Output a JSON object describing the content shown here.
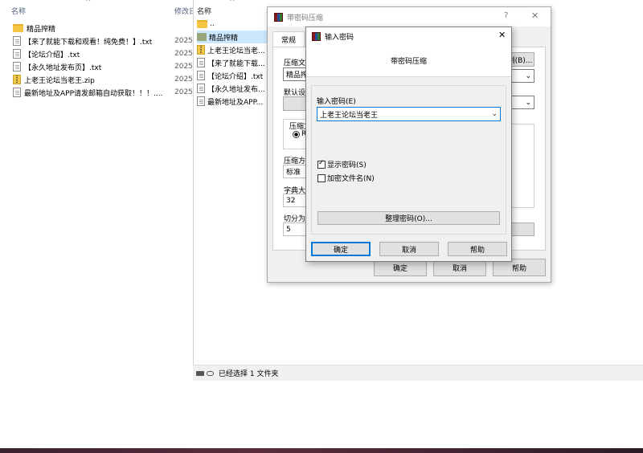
{
  "explorer_bg": {
    "col_name": "名称",
    "col_modified": "修改日",
    "files": [
      {
        "name": "精品搾精",
        "icon": "folder-icon",
        "date": ""
      },
      {
        "name": "【来了就能下载和观看！纯免费！】.txt",
        "icon": "txt-file-icon",
        "date": "2025"
      },
      {
        "name": "【论坛介绍】.txt",
        "icon": "txt-file-icon",
        "date": "2025"
      },
      {
        "name": "【永久地址发布页】.txt",
        "icon": "txt-file-icon",
        "date": "2025"
      },
      {
        "name": "上老王论坛当老王.zip",
        "icon": "zip-file-icon",
        "date": "2025"
      },
      {
        "name": "最新地址及APP请发邮箱自动获取！！！....",
        "icon": "txt-file-icon",
        "date": "2025"
      }
    ]
  },
  "explorer_mid": {
    "col_name": "名称",
    "files": [
      {
        "name": "..",
        "icon": "folder-up-icon"
      },
      {
        "name": "精品搾精",
        "icon": "folder-icon"
      },
      {
        "name": "上老王论坛当老...",
        "icon": "zip-file-icon"
      },
      {
        "name": "【来了就能下载...",
        "icon": "txt-file-icon"
      },
      {
        "name": "【论坛介绍】.txt",
        "icon": "txt-file-icon"
      },
      {
        "name": "【永久地址发布...",
        "icon": "txt-file-icon"
      },
      {
        "name": "最新地址及APP...",
        "icon": "txt-file-icon"
      }
    ],
    "status_text": "已经选择 1 文件夹"
  },
  "dialog_archive": {
    "title": "带密码压缩",
    "help_glyph": "?",
    "close_glyph": "✕",
    "tab_general": "常规",
    "label_archive_name": "压缩文",
    "archive_name_value": "精品搾",
    "browse_button": "浏(B)...",
    "label_default": "默认设",
    "label_format": "压缩文",
    "format_option": "R",
    "label_method": "压缩方",
    "method_value": "标准",
    "label_dict": "字典大",
    "dict_value": "32",
    "label_split": "切分为",
    "split_value": "5",
    "ok_button": "确定",
    "cancel_button": "取消",
    "help_button": "帮助"
  },
  "dialog_password": {
    "title": "输入密码",
    "close_glyph": "✕",
    "header": "带密码压缩",
    "label_password": "输入密码(E)",
    "password_value": "上老王论坛当老王",
    "show_password_label": "显示密码(S)",
    "show_password_checked": true,
    "encrypt_names_label": "加密文件名(N)",
    "encrypt_names_checked": false,
    "organize_button": "整理密码(O)...",
    "ok_button": "确定",
    "cancel_button": "取消",
    "help_button": "帮助"
  },
  "colors": {
    "accent": "#0078d7",
    "dialog_bg": "#f0f0f0"
  }
}
